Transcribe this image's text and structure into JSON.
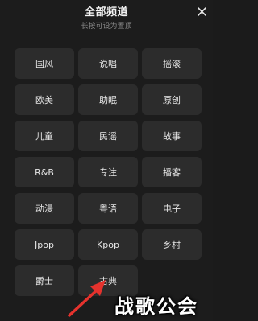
{
  "header": {
    "title": "全部频道",
    "subtitle": "长按可设为置顶"
  },
  "icons": {
    "close": "close-icon",
    "arrow": "arrow-annotation"
  },
  "channels": [
    {
      "label": "国风"
    },
    {
      "label": "说唱"
    },
    {
      "label": "摇滚"
    },
    {
      "label": "欧美"
    },
    {
      "label": "助眠"
    },
    {
      "label": "原创"
    },
    {
      "label": "儿童"
    },
    {
      "label": "民谣"
    },
    {
      "label": "故事"
    },
    {
      "label": "R&B"
    },
    {
      "label": "专注"
    },
    {
      "label": "播客"
    },
    {
      "label": "动漫"
    },
    {
      "label": "粤语"
    },
    {
      "label": "电子"
    },
    {
      "label": "Jpop"
    },
    {
      "label": "Kpop"
    },
    {
      "label": "乡村"
    },
    {
      "label": "爵士"
    },
    {
      "label": "古典"
    }
  ],
  "watermark": {
    "text": "战歌公会"
  },
  "colors": {
    "background": "#1c1c1c",
    "tile": "#2c2c2c",
    "arrow": "#e5322d"
  }
}
